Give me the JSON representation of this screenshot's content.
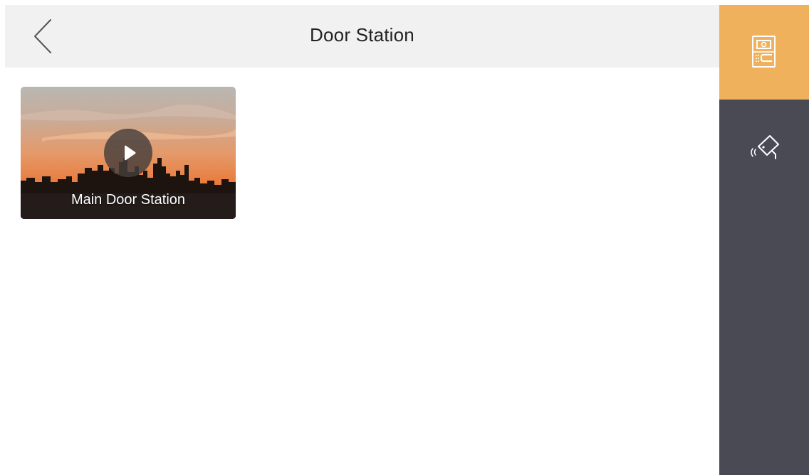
{
  "header": {
    "title": "Door Station"
  },
  "tiles": [
    {
      "label": "Main Door Station"
    }
  ],
  "sidebar": {
    "items": [
      {
        "icon": "door-station-icon",
        "active": true
      },
      {
        "icon": "camera-icon",
        "active": false
      }
    ]
  },
  "colors": {
    "header_bg": "#f1f1f1",
    "sidebar_bg": "#4a4a55",
    "sidebar_active": "#f0b15c"
  }
}
